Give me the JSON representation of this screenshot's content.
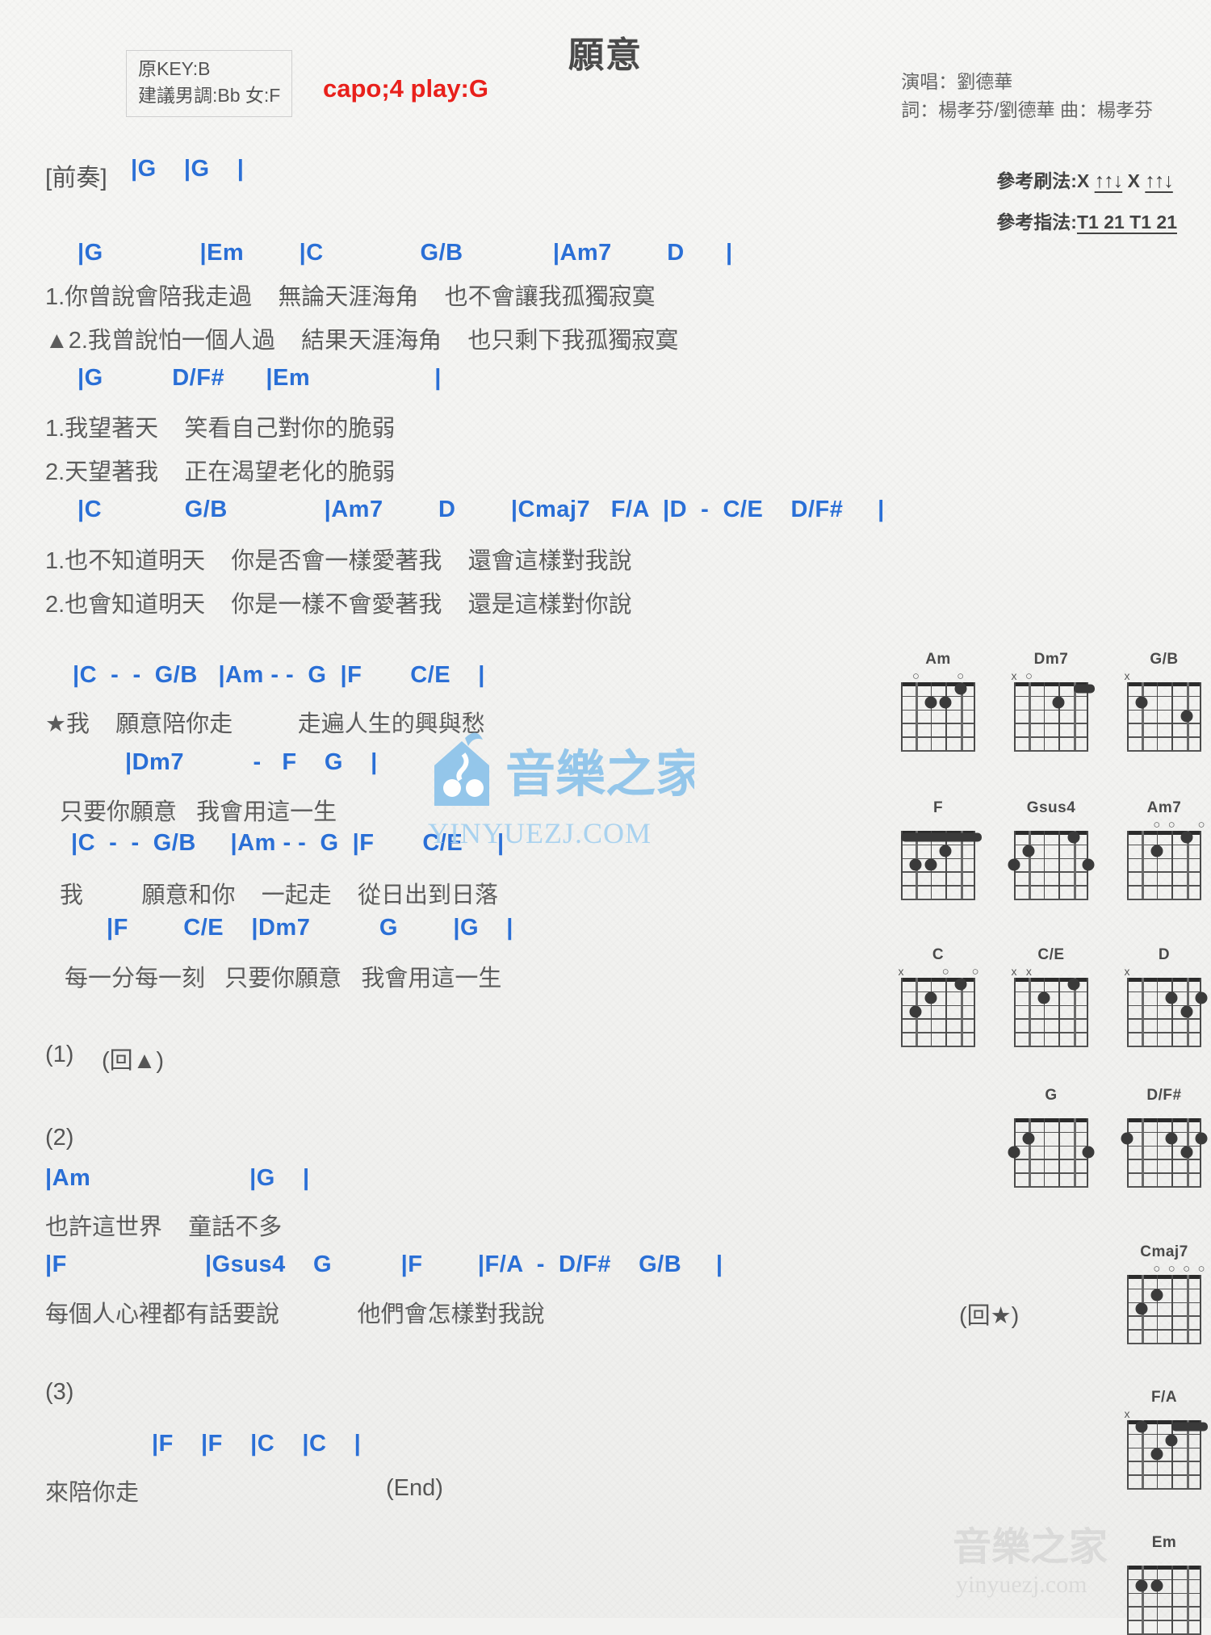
{
  "song": {
    "title": "願意",
    "key_box": {
      "line1": "原KEY:B",
      "line2": "建議男調:Bb 女:F"
    },
    "capo": "capo;4 play:G",
    "credits": {
      "singer": "演唱：劉德華",
      "writers": "詞：楊孝芬/劉德華  曲：楊孝芬"
    },
    "reference": {
      "strum_label": "參考刷法:X",
      "strum_pattern_1": "↑↑↓",
      "strum_mid": "X",
      "strum_pattern_2": "↑↑↓",
      "pick_label": "參考指法:",
      "pick_pattern": "T1 21 T1 21"
    }
  },
  "sections": {
    "intro": {
      "label": "[前奏]",
      "chords": "|G    |G    |"
    },
    "verse1": {
      "chords1": "|G              |Em        |C              G/B             |Am7        D      |",
      "lyric1": "1.你曾說會陪我走過    無論天涯海角    也不會讓我孤獨寂寞",
      "lyric2": "▲2.我曾說怕一個人過    結果天涯海角    也只剩下我孤獨寂寞",
      "chords2": "|G          D/F#      |Em                  |",
      "lyric3": "1.我望著天    笑看自己對你的脆弱",
      "lyric4": "2.天望著我    正在渴望老化的脆弱",
      "chords3": "|C            G/B              |Am7        D        |Cmaj7   F/A  |D  -  C/E    D/F#     |",
      "lyric5": "1.也不知道明天    你是否會一樣愛著我    還會這樣對我說",
      "lyric6": "2.也會知道明天    你是一樣不會愛著我    還是這樣對你說"
    },
    "chorus": {
      "chords1": "|C  -  -  G/B   |Am - -  G  |F       C/E    |",
      "lyric1": "★我    願意陪你走          走遍人生的興與愁",
      "chords2": "|Dm7          -   F    G    |",
      "lyric2": "只要你願意   我會用這一生",
      "chords3": "|C  -  -  G/B     |Am - -  G  |F       C/E     |",
      "lyric3": "我         願意和你    一起走    從日出到日落",
      "chords4": "|F        C/E    |Dm7          G        |G    |",
      "lyric4": "每一分每一刻   只要你願意   我會用這一生"
    },
    "part1": {
      "label": "(1)",
      "text": "(回▲)"
    },
    "part2": {
      "label": "(2)",
      "chords1": "|Am                       |G    |",
      "lyric1": "也許這世界    童話不多",
      "chords2": "|F                    |Gsus4    G          |F        |F/A  -  D/F#    G/B     |",
      "lyric2": "每個人心裡都有話要說            他們會怎樣對我說",
      "repeat": "(回★)"
    },
    "part3": {
      "label": "(3)",
      "chords1": "|F    |F    |C    |C    |",
      "lyric1": "來陪你走",
      "end": "(End)"
    }
  },
  "chord_diagrams": [
    {
      "name": "Am",
      "markers": [
        {
          "s": 5,
          "t": "o"
        },
        {
          "s": 2,
          "t": "o"
        }
      ],
      "dots": [
        {
          "s": 4,
          "f": 2
        },
        {
          "s": 3,
          "f": 2
        },
        {
          "s": 2,
          "f": 1
        }
      ],
      "barre": null
    },
    {
      "name": "Dm7",
      "markers": [
        {
          "s": 6,
          "t": "x"
        },
        {
          "s": 5,
          "t": "o"
        }
      ],
      "dots": [
        {
          "s": 3,
          "f": 2
        }
      ],
      "barre": {
        "f": 1,
        "from": 2,
        "to": 1
      }
    },
    {
      "name": "G/B",
      "markers": [
        {
          "s": 6,
          "t": "x"
        }
      ],
      "dots": [
        {
          "s": 5,
          "f": 2
        },
        {
          "s": 2,
          "f": 3
        }
      ],
      "barre": null
    },
    {
      "name": "F",
      "markers": [],
      "dots": [
        {
          "s": 4,
          "f": 3
        },
        {
          "s": 5,
          "f": 3
        },
        {
          "s": 3,
          "f": 2
        }
      ],
      "barre": {
        "f": 1,
        "from": 6,
        "to": 1
      }
    },
    {
      "name": "Gsus4",
      "markers": [],
      "dots": [
        {
          "s": 6,
          "f": 3
        },
        {
          "s": 5,
          "f": 2
        },
        {
          "s": 2,
          "f": 1
        },
        {
          "s": 1,
          "f": 3
        }
      ],
      "barre": null
    },
    {
      "name": "Am7",
      "markers": [
        {
          "s": 4,
          "t": "o"
        },
        {
          "s": 3,
          "t": "o"
        },
        {
          "s": 1,
          "t": "o"
        }
      ],
      "dots": [
        {
          "s": 4,
          "f": 2
        },
        {
          "s": 2,
          "f": 1
        }
      ],
      "barre": null
    },
    {
      "name": "C",
      "markers": [
        {
          "s": 6,
          "t": "x"
        },
        {
          "s": 3,
          "t": "o"
        },
        {
          "s": 1,
          "t": "o"
        }
      ],
      "dots": [
        {
          "s": 5,
          "f": 3
        },
        {
          "s": 4,
          "f": 2
        },
        {
          "s": 2,
          "f": 1
        }
      ],
      "barre": null
    },
    {
      "name": "C/E",
      "markers": [
        {
          "s": 6,
          "t": "x"
        },
        {
          "s": 5,
          "t": "x"
        }
      ],
      "dots": [
        {
          "s": 4,
          "f": 2
        },
        {
          "s": 2,
          "f": 1
        }
      ],
      "barre": null
    },
    {
      "name": "D",
      "markers": [
        {
          "s": 6,
          "t": "x"
        }
      ],
      "dots": [
        {
          "s": 3,
          "f": 2
        },
        {
          "s": 1,
          "f": 2
        },
        {
          "s": 2,
          "f": 3
        }
      ],
      "barre": null
    },
    {
      "name": "G",
      "markers": [],
      "dots": [
        {
          "s": 5,
          "f": 2
        },
        {
          "s": 6,
          "f": 3
        },
        {
          "s": 1,
          "f": 3
        }
      ],
      "barre": null
    },
    {
      "name": "D/F#",
      "markers": [],
      "dots": [
        {
          "s": 6,
          "f": 2
        },
        {
          "s": 3,
          "f": 2
        },
        {
          "s": 1,
          "f": 2
        },
        {
          "s": 2,
          "f": 3
        }
      ],
      "barre": null
    },
    {
      "name": "Cmaj7",
      "markers": [
        {
          "s": 4,
          "t": "o"
        },
        {
          "s": 3,
          "t": "o"
        },
        {
          "s": 2,
          "t": "o"
        },
        {
          "s": 1,
          "t": "o"
        }
      ],
      "dots": [
        {
          "s": 5,
          "f": 3
        },
        {
          "s": 4,
          "f": 2
        }
      ],
      "barre": null
    },
    {
      "name": "F/A",
      "markers": [
        {
          "s": 6,
          "t": "x"
        }
      ],
      "dots": [
        {
          "s": 5,
          "f": 1
        },
        {
          "s": 4,
          "f": 3
        },
        {
          "s": 3,
          "f": 2
        }
      ],
      "barre": {
        "f": 1,
        "from": 3,
        "to": 1
      }
    },
    {
      "name": "Em",
      "markers": [],
      "dots": [
        {
          "s": 5,
          "f": 2
        },
        {
          "s": 4,
          "f": 2
        }
      ],
      "barre": null
    }
  ],
  "watermark": {
    "brand": "音樂之家",
    "url": "yinyuezj.com"
  },
  "colors": {
    "chord": "#2a6fd6",
    "bar": "#c98a16",
    "capo": "#e8201b",
    "lyric": "#5c5c5c",
    "watermark": "#8fc4ea"
  }
}
